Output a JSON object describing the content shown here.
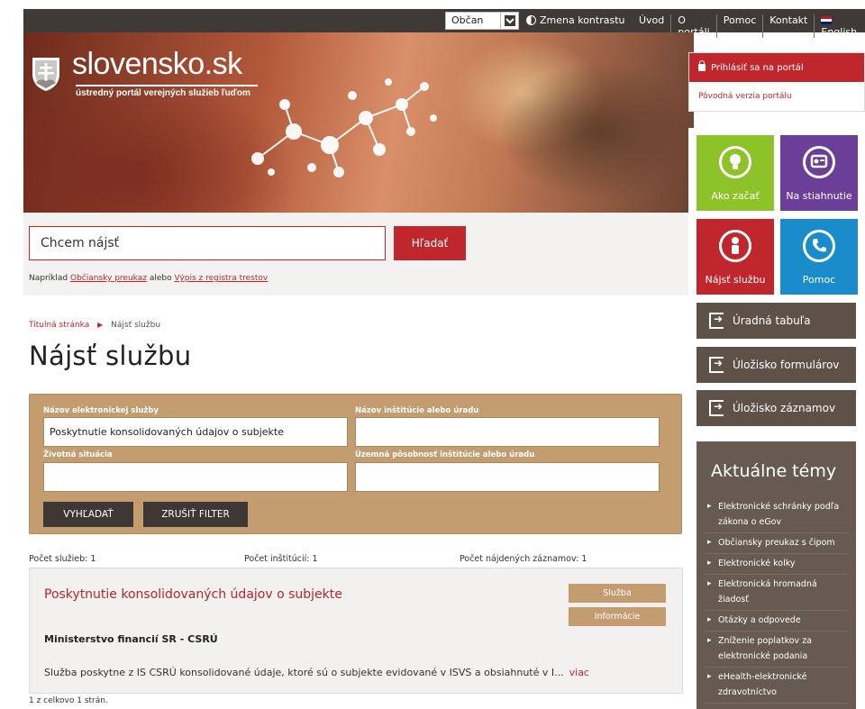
{
  "topbar": {
    "role_value": "Občan",
    "contrast_label": "Zmena kontrastu",
    "links": [
      "Úvod",
      "O portáli",
      "Pomoc",
      "Kontakt"
    ],
    "language": "English"
  },
  "hero": {
    "logo_title": "slovensko.sk",
    "logo_subtitle": "ústredný portál verejných služieb ľuďom"
  },
  "search": {
    "placeholder": "Chcem nájsť",
    "button_label": "Hľadať",
    "hint_prefix": "Napríklad",
    "hint_link1": "Občiansky preukaz",
    "hint_mid": "alebo",
    "hint_link2": "Výpis z registra trestov"
  },
  "sidebar": {
    "login_label": "Prihlásiť sa na portál",
    "old_version_label": "Pôvodná verzia portálu",
    "tiles": [
      {
        "label": "Ako začať",
        "color": "#8ec229"
      },
      {
        "label": "Na stiahnutie",
        "color": "#6b3e98"
      },
      {
        "label": "Nájsť službu",
        "color": "#c0272d"
      },
      {
        "label": "Pomoc",
        "color": "#1a8ccc"
      }
    ],
    "buttons": [
      "Úradná tabuľa",
      "Úložisko formulárov",
      "Úložisko záznamov"
    ],
    "topics_title": "Aktuálne témy",
    "topics": [
      "Elektronické schránky podľa zákona o eGov",
      "Občiansky preukaz s čipom",
      "Elektronické kolky",
      "Elektronická hromadná žiadosť",
      "Otázky a odpovede",
      "Zníženie poplatkov za elektronické podania",
      "eHealth-elektronické zdravotníctvo"
    ]
  },
  "breadcrumb": {
    "home": "Titulná stránka",
    "current": "Nájsť službu"
  },
  "page_title": "Nájsť službu",
  "filter": {
    "service_name_label": "Názov elektronickej služby",
    "service_name_value": "Poskytnutie konsolidovaných údajov o subjekte",
    "institution_label": "Názov inštitúcie alebo úradu",
    "institution_value": "",
    "life_situation_label": "Životná situácia",
    "life_situation_value": "",
    "territory_label": "Územná pôsobnosť inštitúcie alebo úradu",
    "territory_value": "",
    "search_button": "VYHĽADAŤ",
    "reset_button": "ZRUŠIŤ FILTER"
  },
  "counts": {
    "services": "Počet služieb: 1",
    "institutions": "Počet inštitúcií: 1",
    "records": "Počet nájdených záznamov: 1"
  },
  "result": {
    "title": "Poskytnutie konsolidovaných údajov o subjekte",
    "service_button": "Služba",
    "info_button": "Informácie",
    "organization": "Ministerstvo financií SR - CSRÚ",
    "description": "Služba poskytne z IS CSRÚ konsolidované údaje, ktoré sú o subjekte evidované v ISVS a obsiahnuté v I...",
    "more_link": "viac"
  },
  "pagination": "1 z celkovo 1 strán."
}
